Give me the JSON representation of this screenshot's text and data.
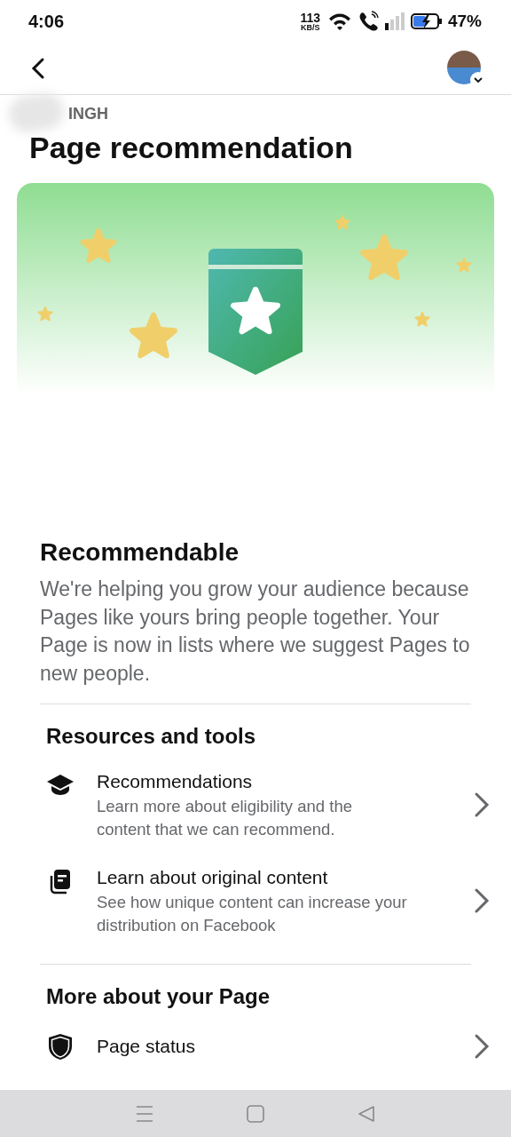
{
  "status_bar": {
    "time": "4:06",
    "speed": "113",
    "speed_unit": "KB/S",
    "battery": "47%"
  },
  "page_name": "INGH",
  "title": "Page recommendation",
  "status_card": {
    "title": "Recommendable",
    "description": "We're helping you grow your audience because Pages like yours bring people together. Your Page is now in lists where we suggest Pages to new people."
  },
  "sections": [
    {
      "heading": "Resources and tools",
      "items": [
        {
          "title": "Recommendations",
          "subtitle": "Learn more about eligibility and the content that we can recommend."
        },
        {
          "title": "Learn about original content",
          "subtitle": "See how unique content can increase your distribution on Facebook"
        }
      ]
    },
    {
      "heading": "More about your Page",
      "items": [
        {
          "title": "Page status"
        }
      ]
    }
  ]
}
